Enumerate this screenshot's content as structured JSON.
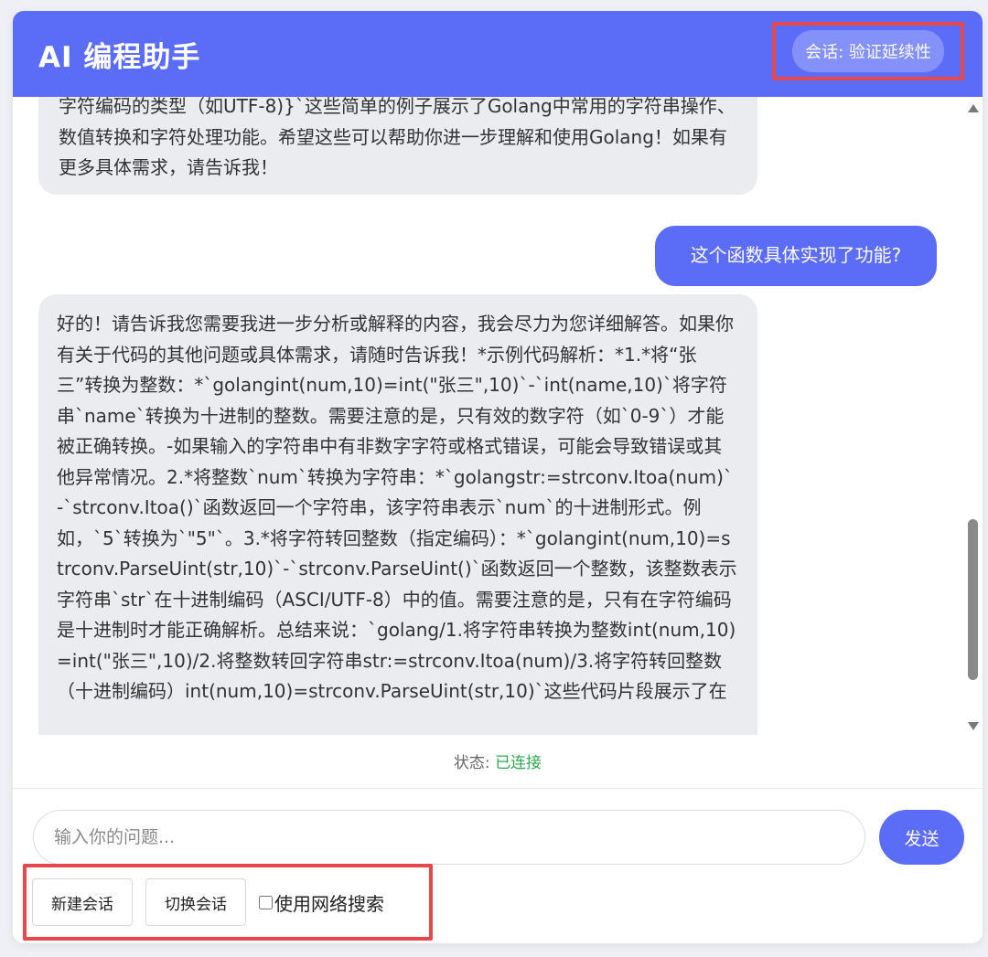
{
  "header": {
    "title": "AI 编程助手",
    "session_badge": "会话: 验证延续性"
  },
  "messages": [
    {
      "role": "assistant",
      "text": "字符编码的类型（如UTF-8)}`这些简单的例子展示了Golang中常用的字符串操作、数值转换和字符处理功能。希望这些可以帮助你进一步理解和使用Golang！如果有更多具体需求，请告诉我！"
    },
    {
      "role": "user",
      "text": "这个函数具体实现了功能?"
    },
    {
      "role": "assistant",
      "text": "好的！请告诉我您需要我进一步分析或解释的内容，我会尽力为您详细解答。如果你有关于代码的其他问题或具体需求，请随时告诉我！*示例代码解析：*1.*将“张三”转换为整数：*`golangint(num,10)=int(\"张三\",10)`-`int(name,10)`将字符串`name`转换为十进制的整数。需要注意的是，只有效的数字符（如`0-9`）才能被正确转换。-如果输入的字符串中有非数字字符或格式错误，可能会导致错误或其他异常情况。2.*将整数`num`转换为字符串：*`golangstr:=strconv.Itoa(num)`-`strconv.Itoa()`函数返回一个字符串，该字符串表示`num`的十进制形式。例如，`5`转换为`\"5\"`。3.*将字符转回整数（指定编码）：*`golangint(num,10)=strconv.ParseUint(str,10)`-`strconv.ParseUint()`函数返回一个整数，该整数表示字符串`str`在十进制编码（ASCI/UTF-8）中的值。需要注意的是，只有在字符编码是十进制时才能正确解析。总结来说：`golang/1.将字符串转换为整数int(num,10)=int(\"张三\",10)/2.将整数转回字符串str:=strconv.Itoa(num)/3.将字符转回整数（十进制编码）int(num,10)=strconv.ParseUint(str,10)`这些代码片段展示了在"
    }
  ],
  "status": {
    "label": "状态: ",
    "value": "已连接",
    "value_color": "#2fa84f"
  },
  "input": {
    "placeholder": "输入你的问题...",
    "value": ""
  },
  "buttons": {
    "send": "发送",
    "new_session": "新建会话",
    "switch_session": "切换会话"
  },
  "web_search": {
    "label": "使用网络搜索",
    "checked": false
  },
  "colors": {
    "accent": "#5b6cf6",
    "highlight_border": "#e5484d",
    "assistant_bubble": "#ebecf0"
  }
}
